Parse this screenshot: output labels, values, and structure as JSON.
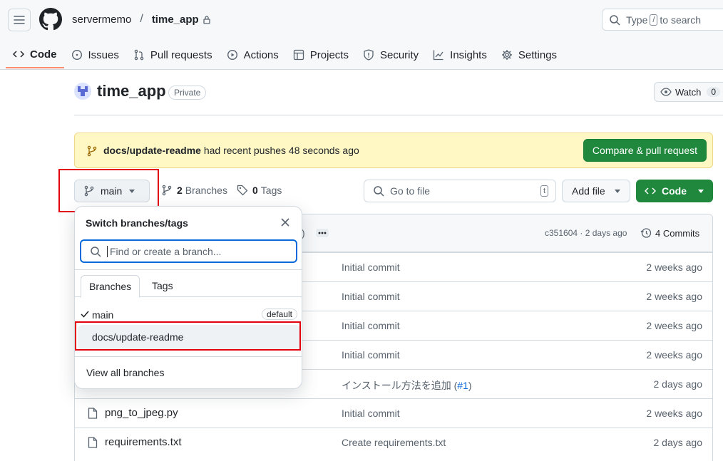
{
  "header": {
    "owner": "servermemo",
    "separator": "/",
    "repo": "time_app",
    "search_prefix": "Type",
    "search_key": "/",
    "search_suffix": "to search"
  },
  "nav": {
    "tabs": [
      {
        "label": "Code",
        "icon": "code-icon",
        "active": true
      },
      {
        "label": "Issues",
        "icon": "issue-icon"
      },
      {
        "label": "Pull requests",
        "icon": "pull-request-icon"
      },
      {
        "label": "Actions",
        "icon": "play-icon"
      },
      {
        "label": "Projects",
        "icon": "table-icon"
      },
      {
        "label": "Security",
        "icon": "shield-icon"
      },
      {
        "label": "Insights",
        "icon": "graph-icon"
      },
      {
        "label": "Settings",
        "icon": "gear-icon"
      }
    ]
  },
  "repo": {
    "name": "time_app",
    "visibility": "Private",
    "watch_label": "Watch",
    "watch_count": "0"
  },
  "banner": {
    "branch": "docs/update-readme",
    "text": "had recent pushes 48 seconds ago",
    "button": "Compare & pull request"
  },
  "toolbar": {
    "branch": "main",
    "branches_count": "2",
    "branches_label": "Branches",
    "tags_count": "0",
    "tags_label": "Tags",
    "goto_placeholder": "Go to file",
    "goto_key": "t",
    "add_file": "Add file",
    "code": "Code"
  },
  "commit_bar": {
    "paren": ")",
    "meta": "c351604 · 2 days ago",
    "commits": "4 Commits"
  },
  "files": [
    {
      "name": "",
      "msg": "Initial commit",
      "date": "2 weeks ago"
    },
    {
      "name": "",
      "msg": "Initial commit",
      "date": "2 weeks ago"
    },
    {
      "name": "",
      "msg": "Initial commit",
      "date": "2 weeks ago"
    },
    {
      "name": "",
      "msg": "Initial commit",
      "date": "2 weeks ago"
    },
    {
      "name": "",
      "msg": "インストール方法を追加 (",
      "link": "#1",
      "msg_end": ")",
      "date": "2 days ago"
    },
    {
      "name": "png_to_jpeg.py",
      "msg": "Initial commit",
      "date": "2 weeks ago"
    },
    {
      "name": "requirements.txt",
      "msg": "Create requirements.txt",
      "date": "2 days ago"
    }
  ],
  "dropdown": {
    "title": "Switch branches/tags",
    "search_placeholder": "Find or create a branch...",
    "tab_branches": "Branches",
    "tab_tags": "Tags",
    "items": [
      {
        "name": "main",
        "badge": "default",
        "checked": true
      },
      {
        "name": "docs/update-readme"
      }
    ],
    "view_all": "View all branches"
  },
  "colors": {
    "accent_green": "#1f883d",
    "highlight_red": "#e3000f",
    "banner_bg": "#fff8c5",
    "nav_underline": "#fd8c73"
  }
}
